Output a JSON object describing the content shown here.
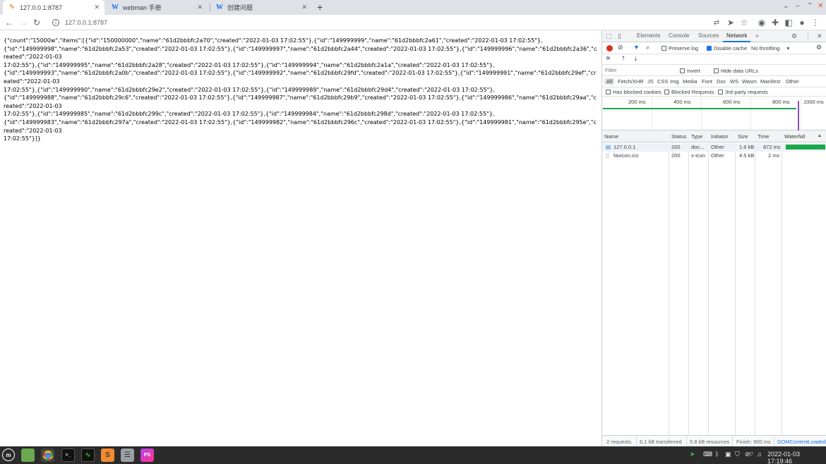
{
  "browser": {
    "tabs": [
      {
        "title": "127.0.0.1:8787",
        "icon": "webman-favicon-icon"
      },
      {
        "title": "webman 手册",
        "icon": "w-favicon-icon"
      },
      {
        "title": "创建问题",
        "icon": "w-favicon-icon"
      }
    ],
    "url": "127.0.0.1:8787",
    "new_tab": "+"
  },
  "page": {
    "json_text": "{\"count\":\"15000w\",\"items\":[{\"id\":\"150000000\",\"name\":\"61d2bbbfc2a70\",\"created\":\"2022-01-03 17:02:55\"},{\"id\":\"149999999\",\"name\":\"61d2bbbfc2a61\",\"created\":\"2022-01-03 17:02:55\"},\n{\"id\":\"149999998\",\"name\":\"61d2bbbfc2a53\",\"created\":\"2022-01-03 17:02:55\"},{\"id\":\"149999997\",\"name\":\"61d2bbbfc2a44\",\"created\":\"2022-01-03 17:02:55\"},{\"id\":\"149999996\",\"name\":\"61d2bbbfc2a36\",\"created\":\"2022-01-03\n17:02:55\"},{\"id\":\"149999995\",\"name\":\"61d2bbbfc2a28\",\"created\":\"2022-01-03 17:02:55\"},{\"id\":\"149999994\",\"name\":\"61d2bbbfc2a1a\",\"created\":\"2022-01-03 17:02:55\"},\n{\"id\":\"149999993\",\"name\":\"61d2bbbfc2a0b\",\"created\":\"2022-01-03 17:02:55\"},{\"id\":\"149999992\",\"name\":\"61d2bbbfc29fd\",\"created\":\"2022-01-03 17:02:55\"},{\"id\":\"149999991\",\"name\":\"61d2bbbfc29ef\",\"created\":\"2022-01-03\n17:02:55\"},{\"id\":\"149999990\",\"name\":\"61d2bbbfc29e2\",\"created\":\"2022-01-03 17:02:55\"},{\"id\":\"149999989\",\"name\":\"61d2bbbfc29d4\",\"created\":\"2022-01-03 17:02:55\"},\n{\"id\":\"149999988\",\"name\":\"61d2bbbfc29c6\",\"created\":\"2022-01-03 17:02:55\"},{\"id\":\"149999987\",\"name\":\"61d2bbbfc29b9\",\"created\":\"2022-01-03 17:02:55\"},{\"id\":\"149999986\",\"name\":\"61d2bbbfc29aa\",\"created\":\"2022-01-03\n17:02:55\"},{\"id\":\"149999985\",\"name\":\"61d2bbbfc299c\",\"created\":\"2022-01-03 17:02:55\"},{\"id\":\"149999984\",\"name\":\"61d2bbbfc298d\",\"created\":\"2022-01-03 17:02:55\"},\n{\"id\":\"149999983\",\"name\":\"61d2bbbfc297a\",\"created\":\"2022-01-03 17:02:55\"},{\"id\":\"149999982\",\"name\":\"61d2bbbfc296c\",\"created\":\"2022-01-03 17:02:55\"},{\"id\":\"149999981\",\"name\":\"61d2bbbfc295e\",\"created\":\"2022-01-03\n17:02:55\"}]}"
  },
  "devtools": {
    "tabs": [
      "Elements",
      "Console",
      "Sources",
      "Network"
    ],
    "active_tab": "Network",
    "more": "»",
    "preserve_log": "Preserve log",
    "disable_cache": "Disable cache",
    "throttling": "No throttling",
    "filter_placeholder": "Filter",
    "invert": "Invert",
    "hide_data_urls": "Hide data URLs",
    "types": [
      "All",
      "Fetch/XHR",
      "JS",
      "CSS",
      "Img",
      "Media",
      "Font",
      "Doc",
      "WS",
      "Wasm",
      "Manifest",
      "Other"
    ],
    "has_blocked_cookies": "Has blocked cookies",
    "blocked_requests": "Blocked Requests",
    "third_party": "3rd-party requests",
    "timeline_ticks": [
      "200 ms",
      "400 ms",
      "600 ms",
      "800 ms",
      "1000 ms"
    ],
    "columns": [
      "Name",
      "Status",
      "Type",
      "Initiator",
      "Size",
      "Time",
      "Waterfall"
    ],
    "requests": [
      {
        "name": "127.0.0.1",
        "status": "200",
        "type": "doc...",
        "initiator": "Other",
        "size": "1.6 kB",
        "time": "872 ms"
      },
      {
        "name": "favicon.ico",
        "status": "200",
        "type": "x-icon",
        "initiator": "Other",
        "size": "4.5 kB",
        "time": "2 ms"
      }
    ],
    "status_bar": {
      "requests": "2 requests",
      "transferred": "6.1 kB transferred",
      "resources": "5.8 kB resources",
      "finish": "Finish: 900 ms",
      "dom": "DOMContentLoaded"
    }
  },
  "taskbar": {
    "datetime": "2022-01-03 17:19:46",
    "apps": [
      "mint-menu-icon",
      "folder-icon",
      "chrome-icon",
      "terminal-icon",
      "system-monitor-icon",
      "sublime-icon",
      "database-icon",
      "phpstorm-icon"
    ],
    "app_labels": {
      "sublime": "S",
      "phpstorm": "PS"
    }
  },
  "colors": {
    "accent": "#1a73e8",
    "record": "#d93025",
    "waterfall": "#1aa84b"
  }
}
